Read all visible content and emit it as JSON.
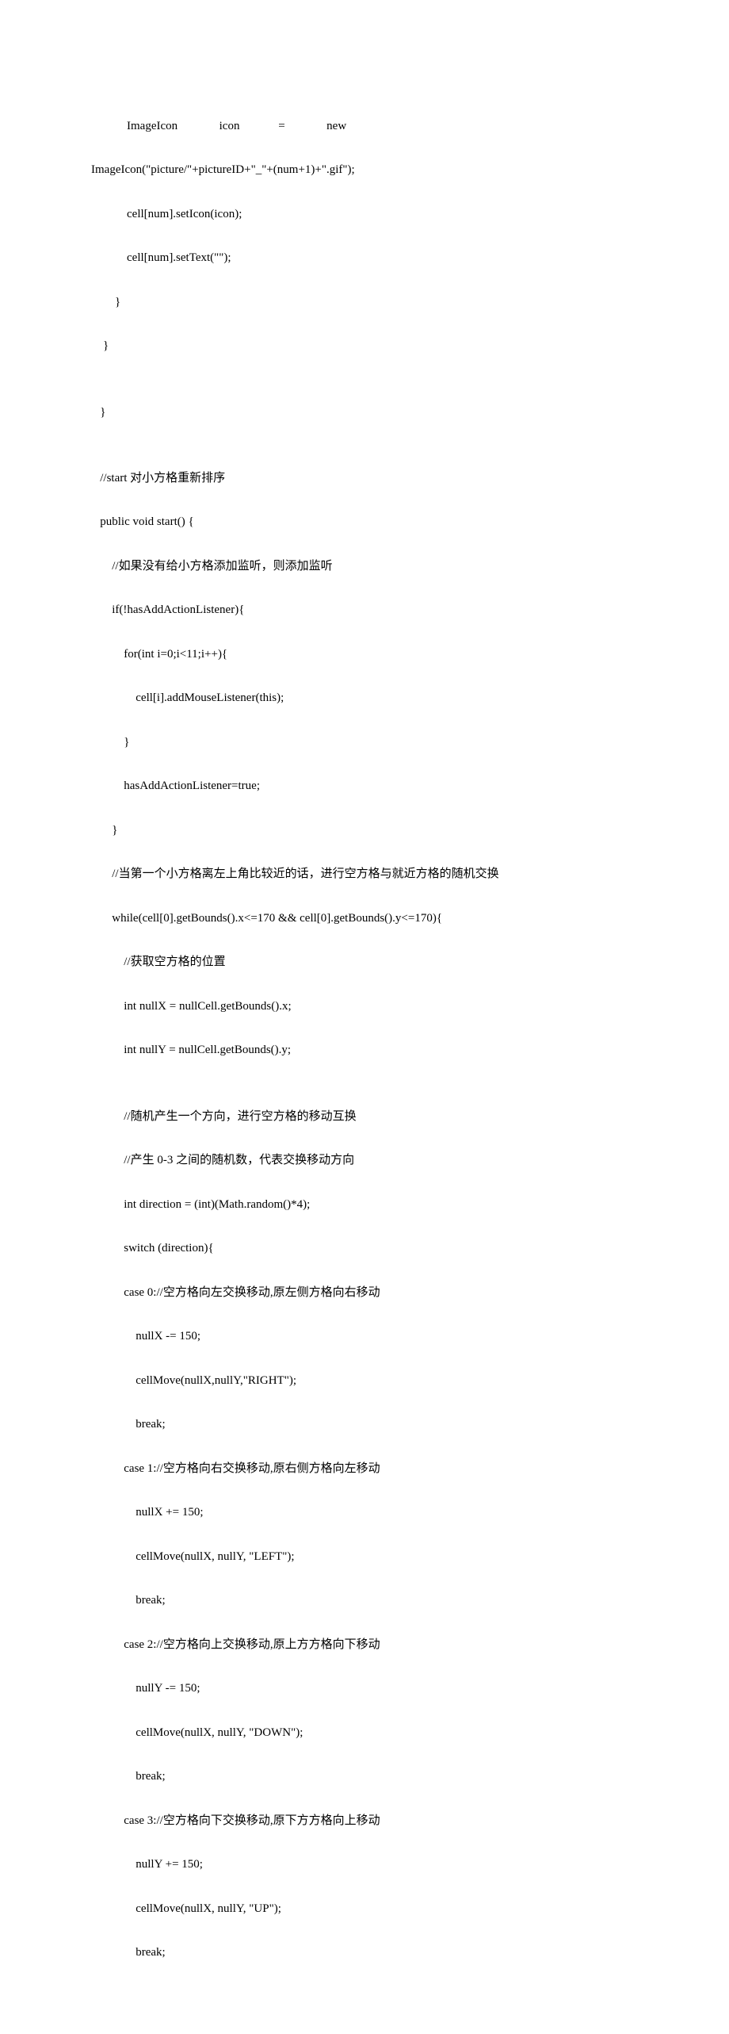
{
  "code": {
    "lines": [
      "            ImageIcon              icon             =              new",
      "ImageIcon(\"picture/\"+pictureID+\"_\"+(num+1)+\".gif\");",
      "            cell[num].setIcon(icon);",
      "            cell[num].setText(\"\");",
      "        }",
      "    }",
      "",
      "   }",
      "",
      "   //start 对小方格重新排序",
      "   public void start() {",
      "       //如果没有给小方格添加监听，则添加监听",
      "       if(!hasAddActionListener){",
      "           for(int i=0;i<11;i++){",
      "               cell[i].addMouseListener(this);",
      "           }",
      "           hasAddActionListener=true;",
      "       }",
      "       //当第一个小方格离左上角比较近的话，进行空方格与就近方格的随机交换",
      "       while(cell[0].getBounds().x<=170 && cell[0].getBounds().y<=170){",
      "           //获取空方格的位置",
      "           int nullX = nullCell.getBounds().x;",
      "           int nullY = nullCell.getBounds().y;",
      "",
      "           //随机产生一个方向，进行空方格的移动互换",
      "           //产生 0-3 之间的随机数，代表交换移动方向",
      "           int direction = (int)(Math.random()*4);",
      "           switch (direction){",
      "           case 0://空方格向左交换移动,原左侧方格向右移动",
      "               nullX -= 150;",
      "               cellMove(nullX,nullY,\"RIGHT\");",
      "               break;",
      "           case 1://空方格向右交换移动,原右侧方格向左移动",
      "               nullX += 150;",
      "               cellMove(nullX, nullY, \"LEFT\");",
      "               break;",
      "           case 2://空方格向上交换移动,原上方方格向下移动",
      "               nullY -= 150;",
      "               cellMove(nullX, nullY, \"DOWN\");",
      "               break;",
      "           case 3://空方格向下交换移动,原下方方格向上移动",
      "               nullY += 150;",
      "               cellMove(nullX, nullY, \"UP\");",
      "               break;"
    ]
  }
}
